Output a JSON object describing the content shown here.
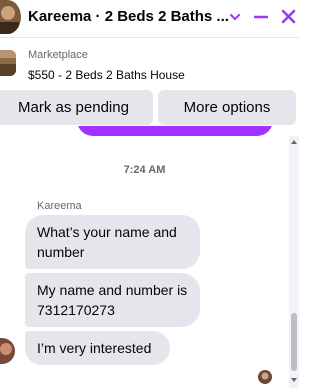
{
  "header": {
    "title": "Kareema · 2 Beds 2 Baths ...",
    "accent_color": "#a033ff",
    "icons": [
      "avatar",
      "chevron-down-icon",
      "minimize-icon",
      "close-icon"
    ]
  },
  "listing": {
    "label": "Marketplace",
    "price_title": "$550 - 2 Beds 2 Baths House"
  },
  "actions": {
    "pending_label": "Mark as pending",
    "more_label": "More options"
  },
  "thread": {
    "timestamp": "7:24 AM",
    "sender_name": "Kareema",
    "messages": [
      {
        "text": "What’s your name and number"
      },
      {
        "text": "My name and number is 7312170273"
      },
      {
        "text": "I’m very interested"
      }
    ],
    "bubble_color": "#e4e6eb"
  }
}
